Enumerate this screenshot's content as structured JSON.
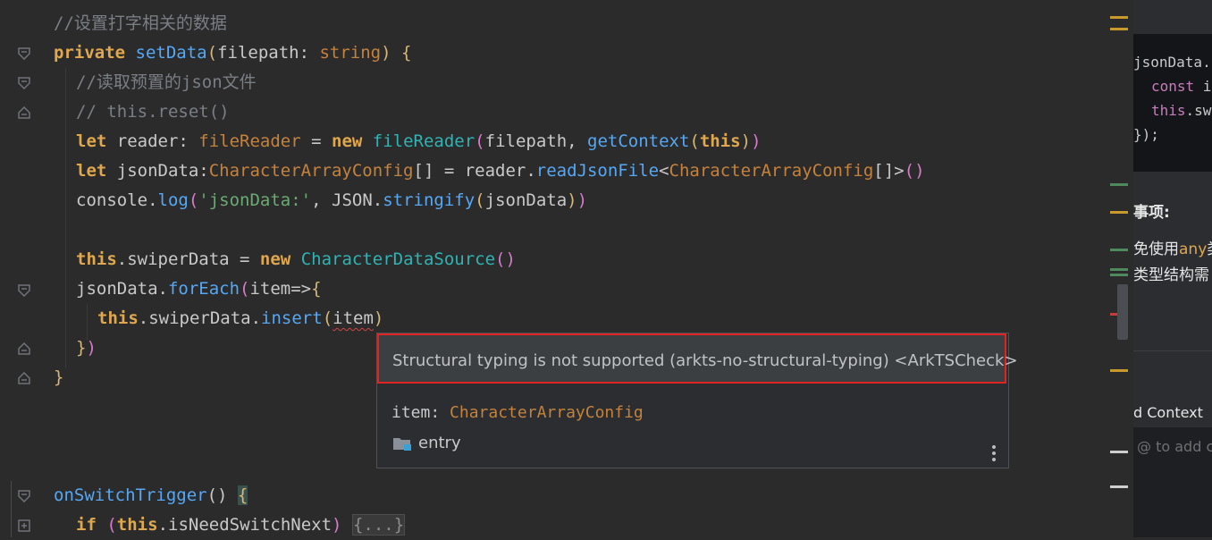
{
  "code": {
    "line1_comment": "//设置打字相关的数据",
    "line2": {
      "kw_private": "private",
      "fn": "setData",
      "p_open": "(",
      "param": "filepath",
      "colon": ": ",
      "type": "string",
      "p_close": ")",
      "space": " ",
      "brace": "{"
    },
    "line3_comment": "//读取预置的json文件",
    "line4_comment": "// this.reset()",
    "line5": {
      "kw_let": "let",
      "var": " reader: ",
      "type": "fileReader",
      "eq": " = ",
      "kw_new": "new",
      "sp": " ",
      "cls": "fileReader",
      "p1": "(",
      "arg": "filepath, ",
      "fn": "getContext",
      "p2": "(",
      "kw_this": "this",
      "p3": ")",
      "p4": ")"
    },
    "line6": {
      "kw_let": "let",
      "var": " jsonData:",
      "type": "CharacterArrayConfig",
      "arr": "[]",
      "eq": " = reader.",
      "fn": "readJsonFile",
      "lt": "<",
      "type2": "CharacterArrayConfig",
      "gt": "[]>",
      "paren": "()"
    },
    "line7": {
      "obj": "console.",
      "fn": "log",
      "p1": "(",
      "str": "'jsonData:'",
      "mid": ", JSON.",
      "fn2": "stringify",
      "p2": "(",
      "arg": "jsonData",
      "p3": ")",
      "p4": ")"
    },
    "line9": {
      "kw_this": "this",
      "prop": ".swiperData = ",
      "kw_new": "new",
      "sp": " ",
      "cls": "CharacterDataSource",
      "paren": "()"
    },
    "line10": {
      "obj": "jsonData.",
      "fn": "forEach",
      "p1": "(",
      "arg": "item=>",
      "brace": "{"
    },
    "line11": {
      "kw_this": "this",
      "prop": ".swiperData.",
      "fn": "insert",
      "p1": "(",
      "arg": "item",
      "p2": ")"
    },
    "line12": {
      "brace": "}",
      "paren": ")"
    },
    "line13": {
      "brace": "}"
    },
    "line17": {
      "fn": "onSwitchTrigger",
      "paren": "() ",
      "brace": "{"
    },
    "line18": {
      "kw_if": "if",
      "sp": " ",
      "p1": "(",
      "kw_this": "this",
      "prop": ".isNeedSwitchNext",
      "p2": ")",
      "sp2": " ",
      "folded": "{...}"
    }
  },
  "popup": {
    "message": "Structural typing is not supported (arkts-no-structural-typing) <ArkTSCheck>",
    "var_name": "item: ",
    "var_type": "CharacterArrayConfig",
    "module": "entry",
    "more_icon": "more-vertical-icon"
  },
  "side_panel": {
    "code_line1": "jsonData.",
    "code_line2_kw": "const",
    "code_line2_rest": " i",
    "code_line3_kw": "this",
    "code_line3_rest": ".sw",
    "code_line4": "});",
    "heading": "事项:",
    "text1_a": "免使用",
    "text1_b": "any",
    "text1_c": "类",
    "text2": "类型结构需",
    "context_title": "d Context",
    "context_placeholder": "@ to add c"
  },
  "colors": {
    "background": "#2b2b2b",
    "error_border": "#e02424",
    "keyword": "#cc7832",
    "function": "#56a8f5",
    "string": "#6aab73"
  }
}
